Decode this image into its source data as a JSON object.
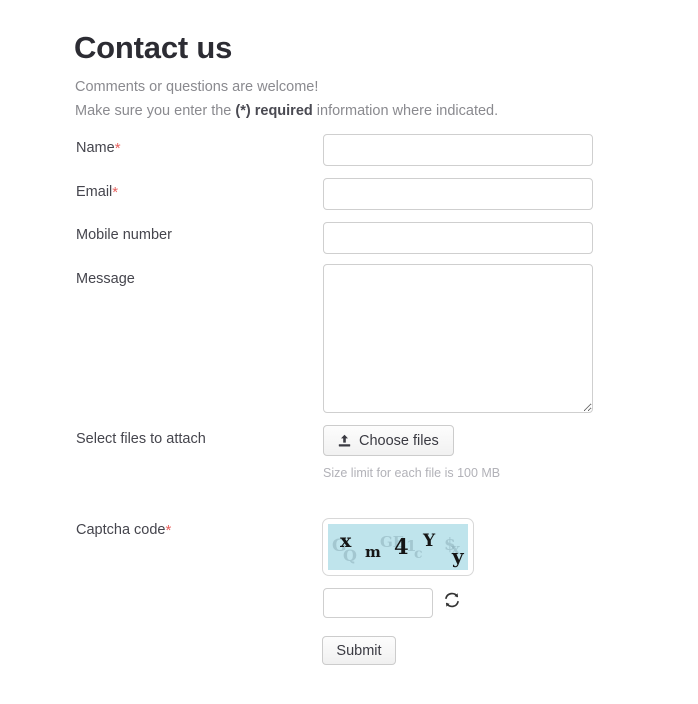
{
  "header": {
    "title": "Contact us",
    "intro_line_1": "Comments or questions are welcome!",
    "intro_prefix": "Make sure you enter the ",
    "intro_required": "(*) required",
    "intro_suffix": " information where indicated."
  },
  "form": {
    "fields": [
      {
        "label": "Name",
        "required": true,
        "value": "",
        "placeholder": ""
      },
      {
        "label": "Email",
        "required": true,
        "value": "",
        "placeholder": ""
      },
      {
        "label": "Mobile number",
        "required": false,
        "value": "",
        "placeholder": ""
      },
      {
        "label": "Message",
        "required": false,
        "value": "",
        "placeholder": ""
      }
    ],
    "attach": {
      "label": "Select files to attach",
      "button_label": "Choose files",
      "button_icon": "upload-icon",
      "size_limit_note": "Size limit for each file is 100 MB"
    },
    "captcha": {
      "label": "Captcha code",
      "required": true,
      "code_characters": [
        "x",
        "m",
        "4",
        "Y",
        "y"
      ],
      "noise_characters": [
        "G",
        "Q",
        "GE",
        "1",
        "c",
        "$",
        "x"
      ],
      "input_value": "",
      "refresh_icon": "refresh-icon",
      "background_color": "#bfe4ec"
    },
    "submit_label": "Submit",
    "required_marker": "*"
  },
  "colors": {
    "asterisk": "#e8615e",
    "title": "#2c2c33",
    "muted_text": "#8a8a8f",
    "label_text": "#45454d",
    "helper_text": "#b2b2b8",
    "input_border": "#cfcfcf",
    "captcha_bg": "#bfe4ec"
  }
}
